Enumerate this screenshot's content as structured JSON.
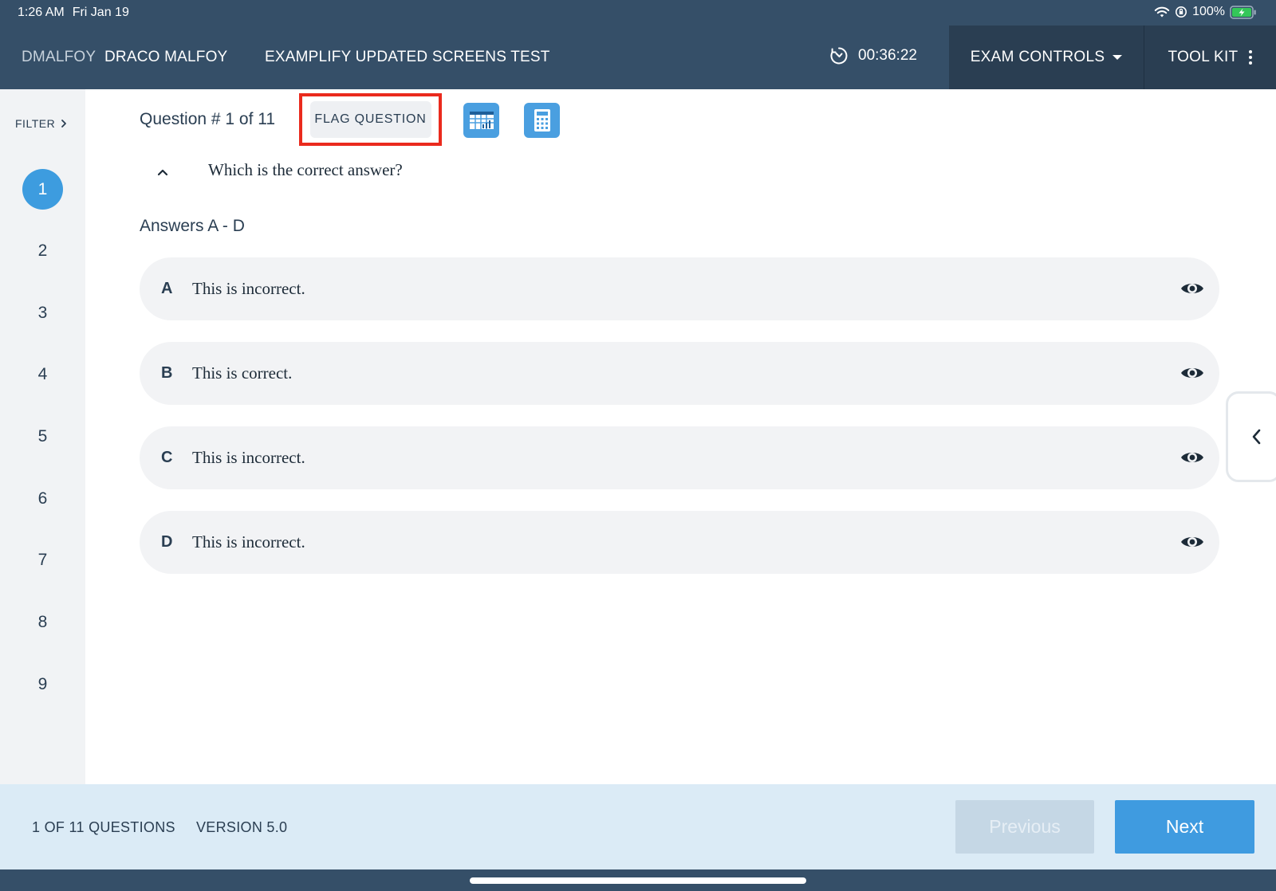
{
  "status_bar": {
    "time": "1:26 AM",
    "date": "Fri Jan 19",
    "battery": "100%"
  },
  "header": {
    "username": "DMALFOY",
    "full_name": "DRACO MALFOY",
    "exam_title": "EXAMPLIFY UPDATED SCREENS TEST",
    "timer": "00:36:22",
    "exam_controls_label": "EXAM CONTROLS",
    "toolkit_label": "TOOL KIT"
  },
  "sidebar": {
    "filter_label": "FILTER",
    "questions": [
      "1",
      "2",
      "3",
      "4",
      "5",
      "6",
      "7",
      "8",
      "9"
    ],
    "active_index": 0
  },
  "question": {
    "label": "Question # 1 of 11",
    "flag_label": "FLAG QUESTION",
    "text": "Which is the correct answer?",
    "answers_label": "Answers A - D"
  },
  "answers": [
    {
      "letter": "A",
      "text": "This is incorrect."
    },
    {
      "letter": "B",
      "text": "This is correct."
    },
    {
      "letter": "C",
      "text": "This is incorrect."
    },
    {
      "letter": "D",
      "text": "This is incorrect."
    }
  ],
  "footer": {
    "count": "1 OF 11 QUESTIONS",
    "version": "VERSION 5.0",
    "previous_label": "Previous",
    "next_label": "Next"
  },
  "colors": {
    "header": "#354f68",
    "accent": "#3f9be0",
    "flag_highlight": "#ea2a1d",
    "footer": "#dbebf6"
  }
}
